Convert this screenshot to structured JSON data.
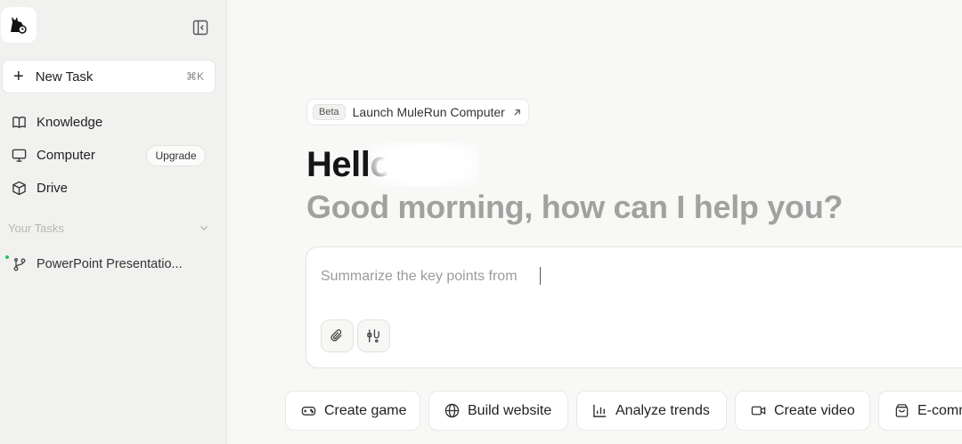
{
  "sidebar": {
    "new_task": {
      "label": "New Task",
      "shortcut": "⌘K"
    },
    "nav": [
      {
        "label": "Knowledge",
        "icon": "book-icon"
      },
      {
        "label": "Computer",
        "icon": "monitor-icon"
      },
      {
        "label": "Drive",
        "icon": "cube-icon"
      }
    ],
    "upgrade_label": "Upgrade",
    "section_title": "Your Tasks",
    "tasks": [
      {
        "label": "PowerPoint Presentatio...",
        "status_color": "#22c55e"
      }
    ]
  },
  "main": {
    "beta_tag": "Beta",
    "beta_link": "Launch MuleRun Computer",
    "greeting": "Hello",
    "subtitle": "Good morning, how can I help you?",
    "composer": {
      "value": "Summarize the key points from"
    },
    "chips": [
      {
        "label": "Create game",
        "icon": "gamepad-icon"
      },
      {
        "label": "Build website",
        "icon": "globe-icon"
      },
      {
        "label": "Analyze trends",
        "icon": "bar-chart-icon"
      },
      {
        "label": "Create video",
        "icon": "video-icon"
      },
      {
        "label": "E-comm",
        "icon": "shopping-bag-icon"
      }
    ]
  }
}
